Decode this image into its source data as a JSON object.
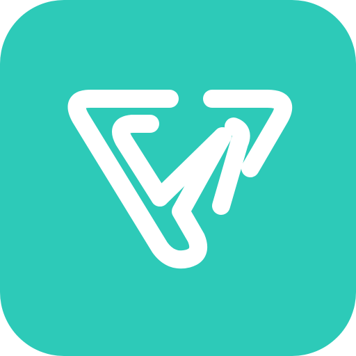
{
  "app_icon": {
    "name": "app-icon",
    "background_color": "#2dcab8",
    "glyph_color": "#ffffff",
    "glyph": "stylized-v-logo-icon"
  }
}
